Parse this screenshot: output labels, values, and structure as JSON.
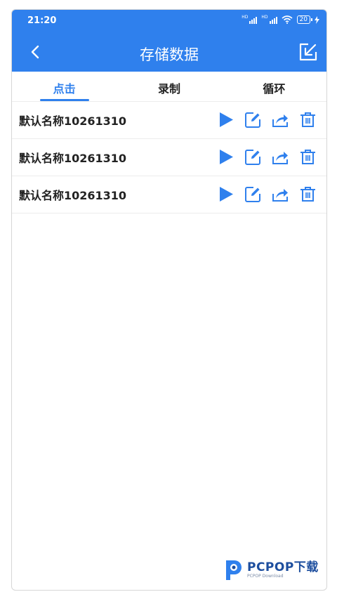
{
  "status_bar": {
    "time": "21:20",
    "battery": "20",
    "signal_label_1": "HD",
    "signal_label_2": "HD"
  },
  "header": {
    "title": "存储数据"
  },
  "tabs": [
    {
      "label": "点击",
      "active": true
    },
    {
      "label": "录制",
      "active": false
    },
    {
      "label": "循环",
      "active": false
    }
  ],
  "records": [
    {
      "name": "默认名称10261310"
    },
    {
      "name": "默认名称10261310"
    },
    {
      "name": "默认名称10261310"
    }
  ],
  "watermark": {
    "text": "PCPOP下载",
    "subtext": "PCPOP Download"
  },
  "colors": {
    "accent": "#2f80ed"
  }
}
